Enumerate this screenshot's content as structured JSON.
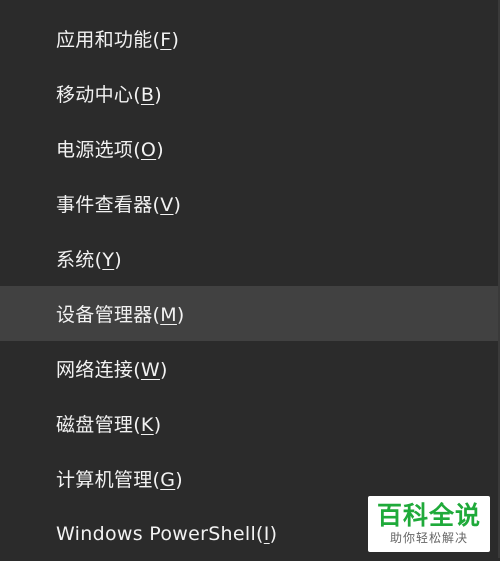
{
  "menu": {
    "items": [
      {
        "label": "应用和功能(",
        "key": "F",
        "close": ")"
      },
      {
        "label": "移动中心(",
        "key": "B",
        "close": ")"
      },
      {
        "label": "电源选项(",
        "key": "O",
        "close": ")"
      },
      {
        "label": "事件查看器(",
        "key": "V",
        "close": ")"
      },
      {
        "label": "系统(",
        "key": "Y",
        "close": ")"
      },
      {
        "label": "设备管理器(",
        "key": "M",
        "close": ")"
      },
      {
        "label": "网络连接(",
        "key": "W",
        "close": ")"
      },
      {
        "label": "磁盘管理(",
        "key": "K",
        "close": ")"
      },
      {
        "label": "计算机管理(",
        "key": "G",
        "close": ")"
      },
      {
        "label": "Windows PowerShell(",
        "key": "I",
        "close": ")"
      }
    ],
    "highlighted_index": 5,
    "highlight_color": "#414141",
    "background_color": "#2b2b2b"
  },
  "watermark": {
    "title": "百科全说",
    "subtitle": "助你轻松解决",
    "title_color": "#1faa3a"
  }
}
